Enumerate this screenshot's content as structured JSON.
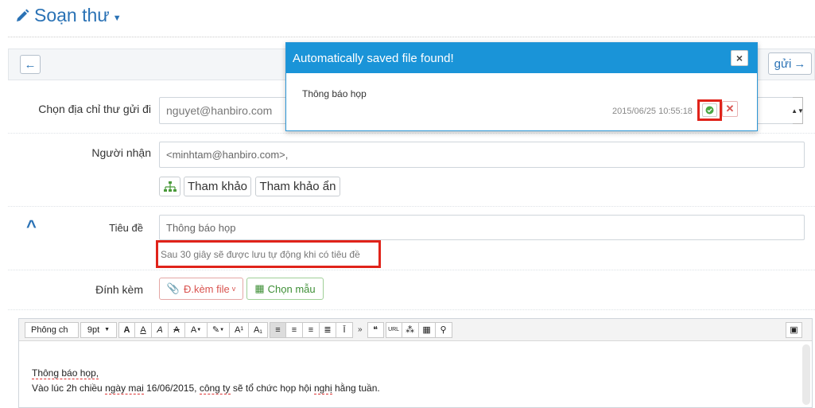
{
  "header": {
    "title": "Soạn thư"
  },
  "toolbar": {
    "send_label": "gửi"
  },
  "form": {
    "from_label": "Chọn địa chỉ thư gửi đi",
    "from_value": "nguyet@hanbiro.com",
    "to_label": "Người nhận",
    "to_value": "<minhtam@hanbiro.com>,",
    "cc_label": "Tham khảo",
    "bcc_label": "Tham khảo ẩn",
    "subject_label": "Tiêu đề",
    "subject_value": "Thông báo họp",
    "subject_hint": "Sau 30 giây sẽ được lưu tự động khi có tiêu đề",
    "attach_label": "Đính kèm",
    "attach_file_label": "Đ.kèm file",
    "template_label": "Chọn mẫu"
  },
  "editor": {
    "font_select": "Phông ch",
    "size_select": "9pt",
    "line1": "Thông báo họp,",
    "line2_a": "Vào lúc 2h chiều ",
    "line2_b": "ngày mai",
    "line2_c": " 16/06/2015, ",
    "line2_d": "công ty",
    "line2_e": " sẽ tổ chức họp hội ",
    "line2_f": "nghị",
    "line2_g": " hằng tuần."
  },
  "modal": {
    "title": "Automatically saved file found!",
    "item_title": "Thông báo họp",
    "item_date": "2015/06/25 10:55:18"
  },
  "colors": {
    "accent": "#2a72b5",
    "modal_header": "#1a94d8",
    "highlight": "#e0231a"
  }
}
